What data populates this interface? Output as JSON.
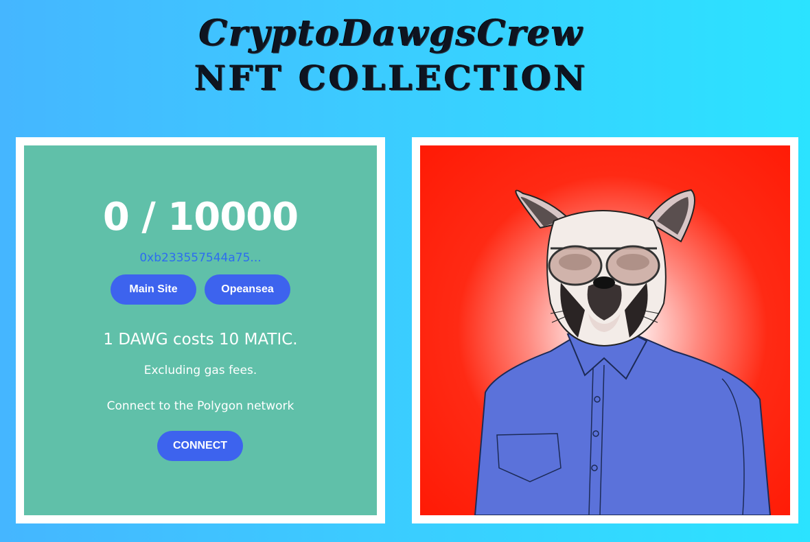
{
  "header": {
    "title_line1": "CryptoDawgsCrew",
    "title_line2": "NFT COLLECTION"
  },
  "mint_panel": {
    "counter": "0 / 10000",
    "contract_address": "0xb233557544a75...",
    "main_site_label": "Main Site",
    "opensea_label": "Opeansea",
    "cost_text": "1 DAWG costs 10 MATIC.",
    "gas_text": "Excluding gas fees.",
    "network_text": "Connect to the Polygon network",
    "connect_label": "CONNECT"
  },
  "preview": {
    "image": "french-bulldog-with-aviator-sunglasses-in-blue-shirt"
  },
  "colors": {
    "background": "#3ccbff",
    "panel": "#60c0a9",
    "button": "#3d63ee",
    "address": "#2d6cf0",
    "art_background": "#ff1a05"
  }
}
